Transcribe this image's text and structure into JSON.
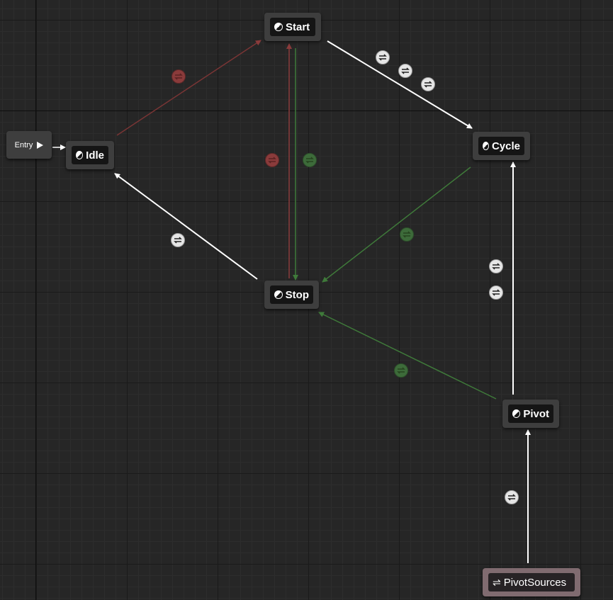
{
  "graph": {
    "entry": {
      "label": "Entry"
    },
    "states": {
      "start": "Start",
      "idle": "Idle",
      "cycle": "Cycle",
      "stop": "Stop",
      "pivot": "Pivot",
      "pivot_sources": "PivotSources"
    }
  },
  "colors": {
    "background": "#262626",
    "node": "#3e3e3e",
    "node_label_bg": "#151515",
    "alias_node": "#806b70",
    "wire_active": "#ffffff",
    "wire_green": "#3f7a3a",
    "wire_red": "#8a3b3b"
  },
  "icons": {
    "transition_rule": "transition-rule-icon",
    "state": "state-icon",
    "alias": "state-alias-icon",
    "entry": "entry-arrow-icon"
  }
}
